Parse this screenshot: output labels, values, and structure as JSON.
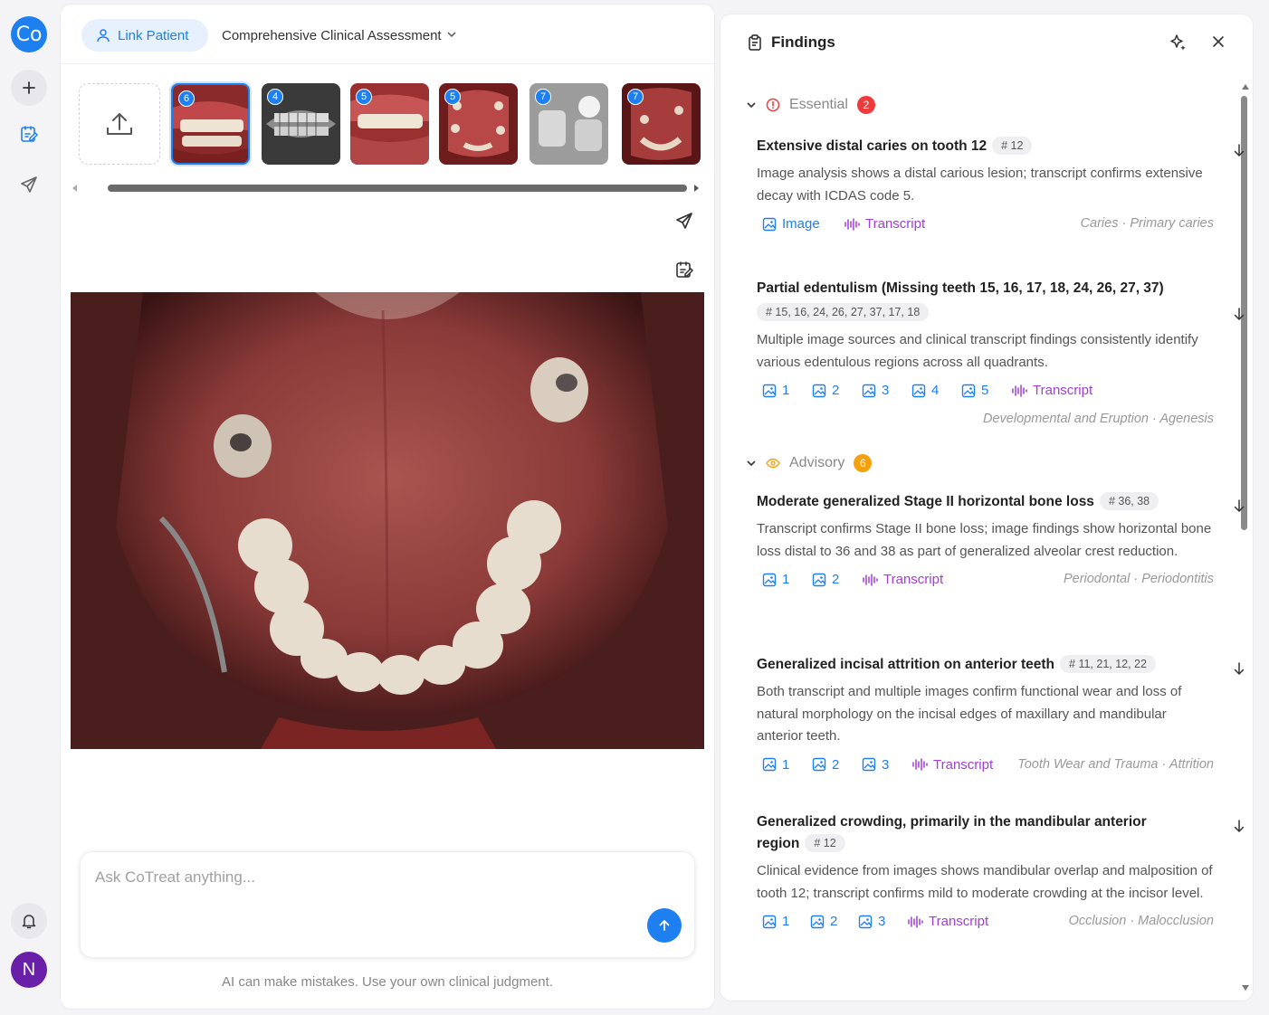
{
  "rail": {
    "logo": "Co",
    "avatar": "N"
  },
  "toolbar": {
    "link_patient": "Link Patient",
    "assessment": "Comprehensive Clinical Assessment"
  },
  "thumbnails": [
    {
      "badge": "6"
    },
    {
      "badge": "4"
    },
    {
      "badge": "5"
    },
    {
      "badge": "5"
    },
    {
      "badge": "7"
    },
    {
      "badge": "7"
    }
  ],
  "chat": {
    "placeholder": "Ask CoTreat anything...",
    "disclaimer": "AI can make mistakes. Use your own clinical judgment."
  },
  "findings": {
    "title": "Findings",
    "essential": {
      "label": "Essential",
      "count": "2"
    },
    "advisory": {
      "label": "Advisory",
      "count": "6"
    },
    "cards": [
      {
        "title": "Extensive distal caries on tooth 12",
        "tag": "# 12",
        "desc": "Image analysis shows a distal carious lesion; transcript confirms extensive decay with ICDAS code 5.",
        "image_label": "Image",
        "transcript": "Transcript",
        "category": "Caries · Primary caries"
      },
      {
        "title": "Partial edentulism (Missing teeth 15, 16, 17, 18, 24, 26, 27, 37)",
        "tag": "# 15, 16, 24, 26, 27, 37, 17, 18",
        "desc": "Multiple image sources and clinical transcript findings consistently identify various edentulous regions across all quadrants.",
        "images": [
          "1",
          "2",
          "3",
          "4",
          "5"
        ],
        "transcript": "Transcript",
        "category": "Developmental and Eruption · Agenesis"
      },
      {
        "title": "Moderate generalized Stage II horizontal bone loss",
        "tag": "# 36, 38",
        "desc": "Transcript confirms Stage II bone loss; image findings show horizontal bone loss distal to 36 and 38 as part of generalized alveolar crest reduction.",
        "images": [
          "1",
          "2"
        ],
        "transcript": "Transcript",
        "category": "Periodontal · Periodontitis"
      },
      {
        "title": "Generalized incisal attrition on anterior teeth",
        "tag": "# 11, 21, 12, 22",
        "desc": "Both transcript and multiple images confirm functional wear and loss of natural morphology on the incisal edges of maxillary and mandibular anterior teeth.",
        "images": [
          "1",
          "2",
          "3"
        ],
        "transcript": "Transcript",
        "category": "Tooth Wear and Trauma · Attrition"
      },
      {
        "title": "Generalized crowding, primarily in the mandibular anterior region",
        "tag": "# 12",
        "desc": "Clinical evidence from images shows mandibular overlap and malposition of tooth 12; transcript confirms mild to moderate crowding at the incisor level.",
        "images": [
          "1",
          "2",
          "3"
        ],
        "transcript": "Transcript",
        "category": "Occlusion · Malocclusion"
      }
    ]
  },
  "colors": {
    "accent": "#1e7ff0",
    "transcript": "#a13ed6",
    "essential": "#ef3b3b",
    "advisory": "#f5a00f",
    "avatar": "#6a1fa8"
  }
}
